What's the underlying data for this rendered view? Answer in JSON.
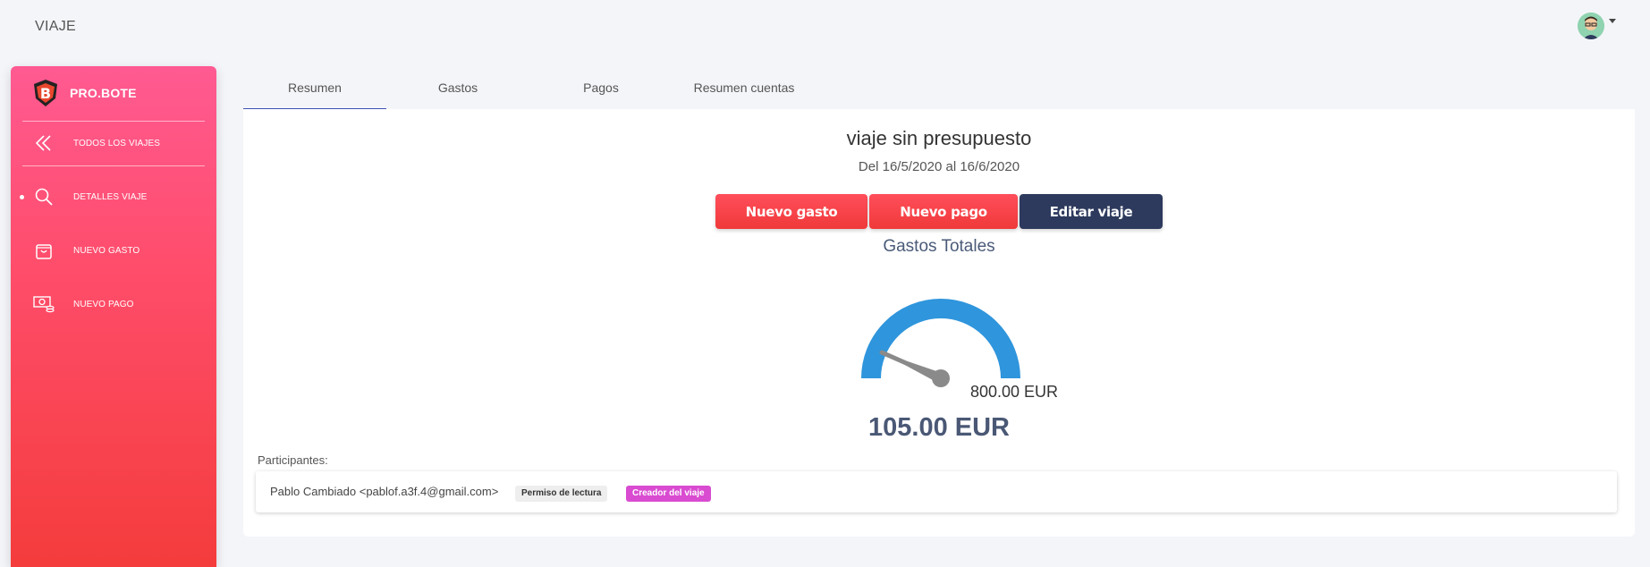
{
  "topbar": {
    "title": "VIAJE"
  },
  "sidebar": {
    "brand": "PRO.BOTE",
    "items": [
      {
        "label": "TODOS LOS VIAJES",
        "icon": "chevrons-left-icon"
      },
      {
        "label": "DETALLES VIAJE",
        "icon": "search-icon",
        "active": true
      },
      {
        "label": "NUEVO GASTO",
        "icon": "shopping-bag-icon"
      },
      {
        "label": "NUEVO PAGO",
        "icon": "money-icon"
      }
    ]
  },
  "tabs": [
    {
      "label": "Resumen",
      "active": true
    },
    {
      "label": "Gastos"
    },
    {
      "label": "Pagos"
    },
    {
      "label": "Resumen cuentas"
    }
  ],
  "trip": {
    "title": "viaje sin presupuesto",
    "dates": "Del 16/5/2020 al 16/6/2020"
  },
  "actions": {
    "new_expense": "Nuevo gasto",
    "new_payment": "Nuevo pago",
    "edit_trip": "Editar viaje"
  },
  "gauge": {
    "label": "Gastos Totales",
    "max_label": "800.00 EUR",
    "value_label": "105.00 EUR",
    "value": 105,
    "max": 800,
    "color": "#2f95dc",
    "needle_color": "#8a8a8a"
  },
  "participants": {
    "label": "Participantes:",
    "list": [
      {
        "name": "Pablo Cambiado <pablof.a3f.4@gmail.com>",
        "badges": [
          "Permiso de lectura",
          "Creador del viaje"
        ]
      }
    ]
  },
  "colors": {
    "accent_red": "#f03a3a",
    "sidebar_pink": "#ff5a92",
    "dark_button": "#2d3a5d",
    "tab_indicator": "#3f51b5",
    "creator_badge": "#d94bd0"
  }
}
